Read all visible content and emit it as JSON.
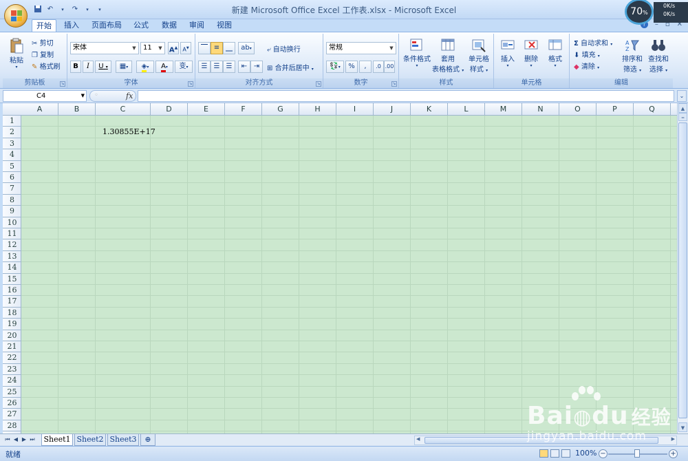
{
  "window": {
    "title": "新建 Microsoft Office Excel 工作表.xlsx - Microsoft Excel",
    "controls": [
      "–",
      "▫",
      "✕"
    ]
  },
  "system": {
    "cpu_percent": "70",
    "pct_sign": "%",
    "up_speed": "0K/s",
    "down_speed": "0K/s"
  },
  "ribbon": {
    "tabs": [
      {
        "label": "开始",
        "active": true
      },
      {
        "label": "插入"
      },
      {
        "label": "页面布局"
      },
      {
        "label": "公式"
      },
      {
        "label": "数据"
      },
      {
        "label": "审阅"
      },
      {
        "label": "视图"
      }
    ],
    "clipboard": {
      "label": "剪贴板",
      "paste": "粘贴",
      "cut": "剪切",
      "copy": "复制",
      "format_painter": "格式刷"
    },
    "font": {
      "label": "字体",
      "font_name": "宋体",
      "font_size": "11",
      "bold": "B",
      "italic": "I",
      "underline": "U",
      "grow": "A",
      "shrink": "A",
      "font_color": "A",
      "phonetic": "变"
    },
    "alignment": {
      "label": "对齐方式",
      "wrap_text": "自动换行",
      "merge_center": "合并后居中"
    },
    "number": {
      "label": "数字",
      "format": "常规",
      "percent": "%",
      "comma": ","
    },
    "styles": {
      "label": "样式",
      "conditional": "条件格式",
      "table_format_1": "套用",
      "table_format_2": "表格格式",
      "cell_styles_1": "单元格",
      "cell_styles_2": "样式"
    },
    "cells": {
      "label": "单元格",
      "insert": "插入",
      "delete": "删除",
      "format": "格式"
    },
    "editing": {
      "label": "编辑",
      "autosum": "自动求和",
      "fill": "填充",
      "clear": "清除",
      "sort_1": "排序和",
      "sort_2": "筛选",
      "find_1": "查找和",
      "find_2": "选择"
    }
  },
  "formula_bar": {
    "name_box": "C4",
    "fx": "fx",
    "formula": ""
  },
  "sheet": {
    "columns": [
      "A",
      "B",
      "C",
      "D",
      "E",
      "F",
      "G",
      "H",
      "I",
      "J",
      "K",
      "L",
      "M",
      "N",
      "O",
      "P",
      "Q"
    ],
    "rows": [
      "1",
      "2",
      "3",
      "4",
      "5",
      "6",
      "7",
      "8",
      "9",
      "10",
      "11",
      "12",
      "13",
      "14",
      "15",
      "16",
      "17",
      "18",
      "19",
      "20",
      "21",
      "22",
      "23",
      "24",
      "25",
      "26",
      "27",
      "28"
    ],
    "cells": [
      {
        "ref": "C2",
        "value": "1.30855E+17"
      }
    ]
  },
  "sheet_tabs": [
    {
      "label": "Sheet1",
      "active": true
    },
    {
      "label": "Sheet2"
    },
    {
      "label": "Sheet3"
    }
  ],
  "status": {
    "text": "就绪",
    "zoom": "100%"
  },
  "watermark": {
    "main": "Bai",
    "main2": "du",
    "cn": "经验",
    "url": "jingyan.baidu.com"
  },
  "colors": {
    "grid_bg": "#cce8cf",
    "ribbon_text": "#15428b",
    "office_orange": "#e8a93a"
  }
}
